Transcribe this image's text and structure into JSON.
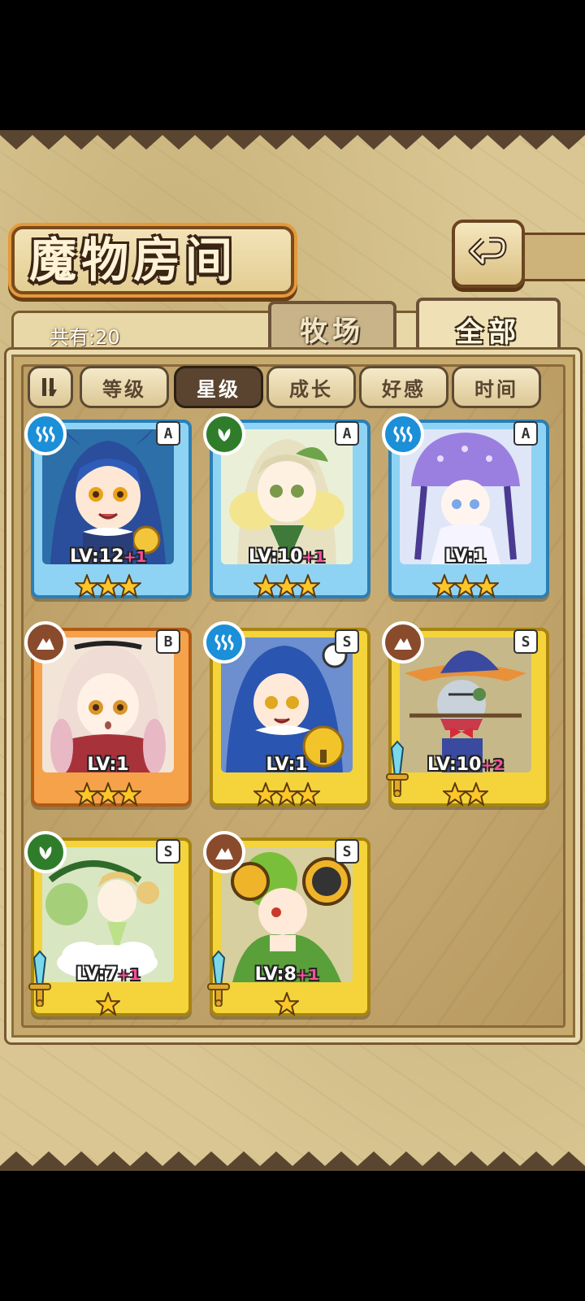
{
  "header": {
    "title": "魔物房间",
    "back_icon": "back-return-icon"
  },
  "count": {
    "label": "共有:20"
  },
  "tabs": [
    {
      "label": "牧场",
      "active": false
    },
    {
      "label": "全部",
      "active": true
    }
  ],
  "sort": {
    "toggle_icon": "sort-direction-icon",
    "options": [
      {
        "label": "等级",
        "active": false
      },
      {
        "label": "星级",
        "active": true
      },
      {
        "label": "成长",
        "active": false
      },
      {
        "label": "好感",
        "active": false
      },
      {
        "label": "时间",
        "active": false
      }
    ]
  },
  "colors": {
    "water": "#1b8fd8",
    "grass": "#2f7d2a",
    "earth": "#8a4a2c",
    "frame_blue": "#7cc9ee",
    "frame_orange": "#f08a2e",
    "frame_gold": "#f2cf2f",
    "plus_pink": "#ff4f9a"
  },
  "monsters": [
    {
      "rank": "A",
      "element": "water-element-icon",
      "level": "LV:12",
      "bonus": "+1",
      "stars": 3,
      "frame": "blue",
      "portrait": "blue-haired-cat-girl-portrait"
    },
    {
      "rank": "A",
      "element": "grass-element-icon",
      "level": "LV:10",
      "bonus": "+1",
      "stars": 3,
      "frame": "blue",
      "portrait": "leaf-fairy-girl-portrait"
    },
    {
      "rank": "A",
      "element": "water-element-icon",
      "level": "LV:1",
      "bonus": "",
      "stars": 3,
      "frame": "blue",
      "portrait": "jellyfish-girl-portrait"
    },
    {
      "rank": "B",
      "element": "earth-element-icon",
      "level": "LV:1",
      "bonus": "",
      "stars": 3,
      "frame": "orange",
      "portrait": "rabbit-girl-portrait"
    },
    {
      "rank": "S",
      "element": "water-element-icon",
      "level": "LV:1",
      "bonus": "",
      "stars": 3,
      "frame": "gold",
      "portrait": "bell-cat-girl-portrait"
    },
    {
      "rank": "S",
      "element": "earth-element-icon",
      "level": "LV:10",
      "bonus": "+2",
      "stars": 2,
      "frame": "gold",
      "portrait": "scarecrow-witch-portrait",
      "weapon": "sword-icon"
    },
    {
      "rank": "S",
      "element": "grass-element-icon",
      "level": "LV:7",
      "bonus": "+1",
      "stars": 1,
      "frame": "gold",
      "portrait": "cloud-fairy-portrait",
      "weapon": "sword-icon"
    },
    {
      "rank": "S",
      "element": "earth-element-icon",
      "level": "LV:8",
      "bonus": "+1",
      "stars": 1,
      "frame": "gold",
      "portrait": "green-frog-girl-portrait",
      "weapon": "sword-icon"
    }
  ]
}
